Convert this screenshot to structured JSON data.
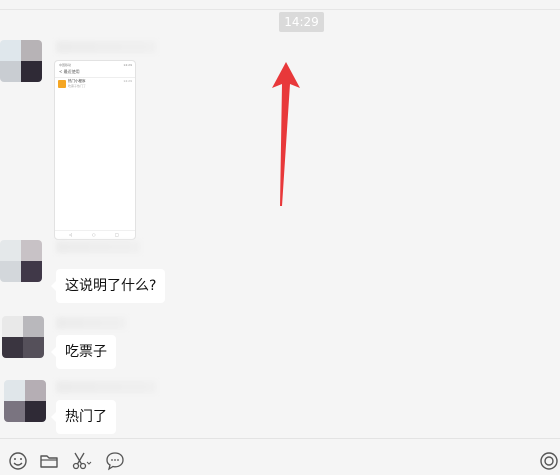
{
  "time_divider": "14:29",
  "messages": [
    {
      "type": "image",
      "content": {
        "status_left": "中国移动",
        "status_right": "14:29",
        "header": "< 最近使用",
        "app_title": "热门小程序",
        "app_subtitle": "吃票子热门了",
        "app_time": "14:29",
        "nav": [
          "◁",
          "○",
          "□"
        ]
      }
    },
    {
      "type": "text",
      "text": "这说明了什么?"
    },
    {
      "type": "text",
      "text": "吃票子"
    },
    {
      "type": "text",
      "text": "热门了"
    }
  ],
  "annotation": {
    "arrow_color": "#e8383a"
  },
  "toolbar": {
    "icons": [
      "emoji-icon",
      "folder-icon",
      "scissors-icon",
      "chat-bubble-icon",
      "video-call-icon"
    ]
  },
  "colors": {
    "background": "#f5f5f5",
    "bubble": "#ffffff",
    "timestamp_bg": "#dadada"
  }
}
